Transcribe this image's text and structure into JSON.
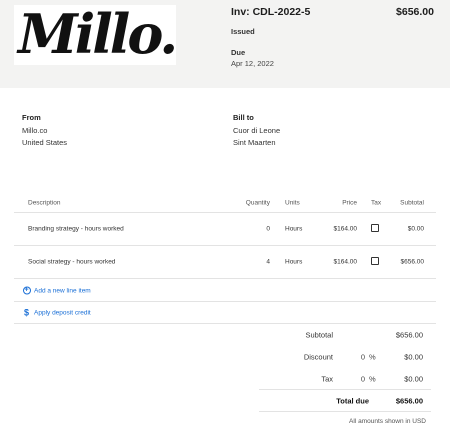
{
  "header": {
    "logo_text": "Millo.",
    "invoice_number": "Inv: CDL-2022-5",
    "invoice_total": "$656.00",
    "status": "Issued",
    "due_label": "Due",
    "due_date": "Apr 12, 2022"
  },
  "from": {
    "label": "From",
    "lines": [
      "Millo.co",
      "United States"
    ]
  },
  "bill_to": {
    "label": "Bill to",
    "lines": [
      "Cuor di Leone",
      "Sint Maarten"
    ]
  },
  "table": {
    "headers": {
      "description": "Description",
      "quantity": "Quantity",
      "units": "Units",
      "price": "Price",
      "tax": "Tax",
      "subtotal": "Subtotal"
    },
    "rows": [
      {
        "description": "Branding strategy - hours worked",
        "quantity": "0",
        "units": "Hours",
        "price": "$164.00",
        "tax_checked": false,
        "subtotal": "$0.00"
      },
      {
        "description": "Social strategy - hours worked",
        "quantity": "4",
        "units": "Hours",
        "price": "$164.00",
        "tax_checked": false,
        "subtotal": "$656.00"
      }
    ]
  },
  "actions": {
    "add_line": "Add a new line item",
    "add_line_icon": "plus-circle-icon",
    "deposit": "Apply deposit credit",
    "deposit_icon": "dollar-icon"
  },
  "totals": {
    "subtotal_label": "Subtotal",
    "subtotal_value": "$656.00",
    "discount_label": "Discount",
    "discount_percent": "0",
    "discount_value": "$0.00",
    "tax_label": "Tax",
    "tax_percent": "0",
    "tax_value": "$0.00",
    "percent_sign": "%",
    "total_due_label": "Total due",
    "total_due_value": "$656.00"
  },
  "footnote": "All amounts shown in USD",
  "colors": {
    "accent": "#1a6fd6",
    "header_bg": "#f3f3f2"
  }
}
